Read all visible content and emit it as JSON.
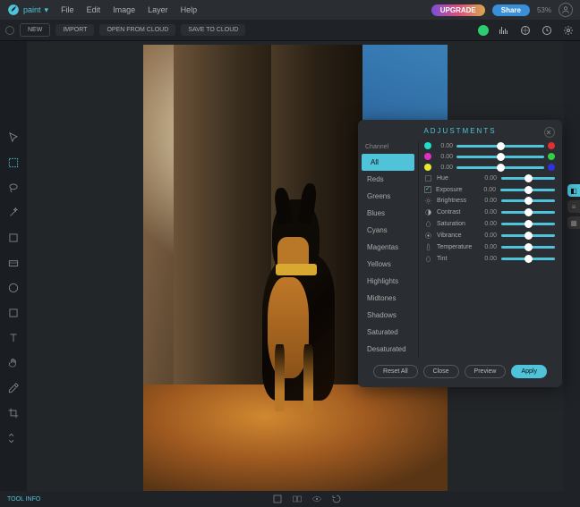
{
  "app": {
    "name": "paint",
    "zoom": "53%"
  },
  "menu": {
    "file": "File",
    "edit": "Edit",
    "image": "Image",
    "layer": "Layer",
    "help": "Help"
  },
  "topright": {
    "upgrade": "UPGRADE",
    "share": "Share"
  },
  "actions": {
    "new": "NEW",
    "import": "IMPORT",
    "open_cloud": "OPEN FROM CLOUD",
    "save_cloud": "SAVE TO CLOUD"
  },
  "bottom": {
    "tool_info": "TOOL INFO"
  },
  "panel": {
    "title": "ADJUSTMENTS",
    "channel_label": "Channel",
    "channels": [
      "All",
      "Reds",
      "Greens",
      "Blues",
      "Cyans",
      "Magentas",
      "Yellows",
      "Highlights",
      "Midtones",
      "Shadows",
      "Saturated",
      "Desaturated"
    ],
    "color_sliders": [
      {
        "left": "#1fe0c8",
        "right": "#e03030",
        "value": "0.00"
      },
      {
        "left": "#e030c0",
        "right": "#30d040",
        "value": "0.00"
      },
      {
        "left": "#e8e830",
        "right": "#3030e0",
        "value": "0.00"
      }
    ],
    "named_sliders": [
      {
        "icon": "hue-icon",
        "label": "Hue",
        "value": "0.00",
        "checkbox": false
      },
      {
        "icon": "exposure-icon",
        "label": "Exposure",
        "value": "0.00",
        "checkbox": true
      },
      {
        "icon": "brightness-icon",
        "label": "Brightness",
        "value": "0.00",
        "checkbox": false
      },
      {
        "icon": "contrast-icon",
        "label": "Contrast",
        "value": "0.00",
        "checkbox": false
      },
      {
        "icon": "saturation-icon",
        "label": "Saturation",
        "value": "0.00",
        "checkbox": false
      },
      {
        "icon": "vibrance-icon",
        "label": "Vibrance",
        "value": "0.00",
        "checkbox": false
      },
      {
        "icon": "temperature-icon",
        "label": "Temperature",
        "value": "0.00",
        "checkbox": false
      },
      {
        "icon": "tint-icon",
        "label": "Tint",
        "value": "0.00",
        "checkbox": false
      }
    ],
    "buttons": {
      "reset": "Reset All",
      "close": "Close",
      "preview": "Preview",
      "apply": "Apply"
    }
  },
  "tools": [
    "pointer",
    "marquee",
    "lasso",
    "wand",
    "brush",
    "fill",
    "gradient",
    "shape",
    "text",
    "hand",
    "eyedropper",
    "crop",
    "zoom"
  ],
  "colors": {
    "accent": "#4fc3d9"
  }
}
